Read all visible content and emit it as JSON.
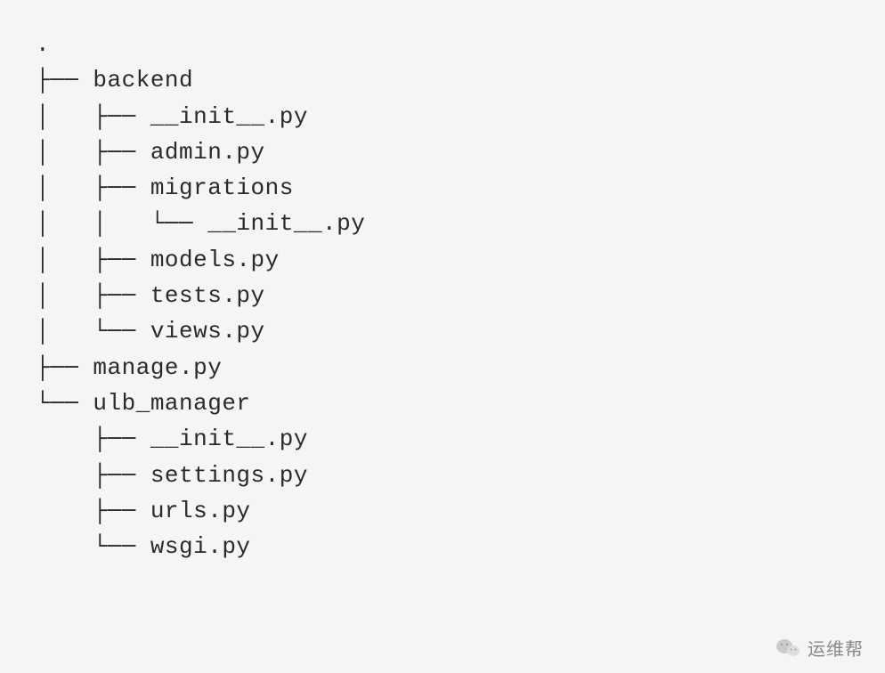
{
  "tree": {
    "lines": [
      ".",
      "├── backend",
      "│   ├── __init__.py",
      "│   ├── admin.py",
      "│   ├── migrations",
      "│   │   └── __init__.py",
      "│   ├── models.py",
      "│   ├── tests.py",
      "│   └── views.py",
      "├── manage.py",
      "└── ulb_manager",
      "    ├── __init__.py",
      "    ├── settings.py",
      "    ├── urls.py",
      "    └── wsgi.py"
    ]
  },
  "watermark": {
    "text": "运维帮"
  }
}
